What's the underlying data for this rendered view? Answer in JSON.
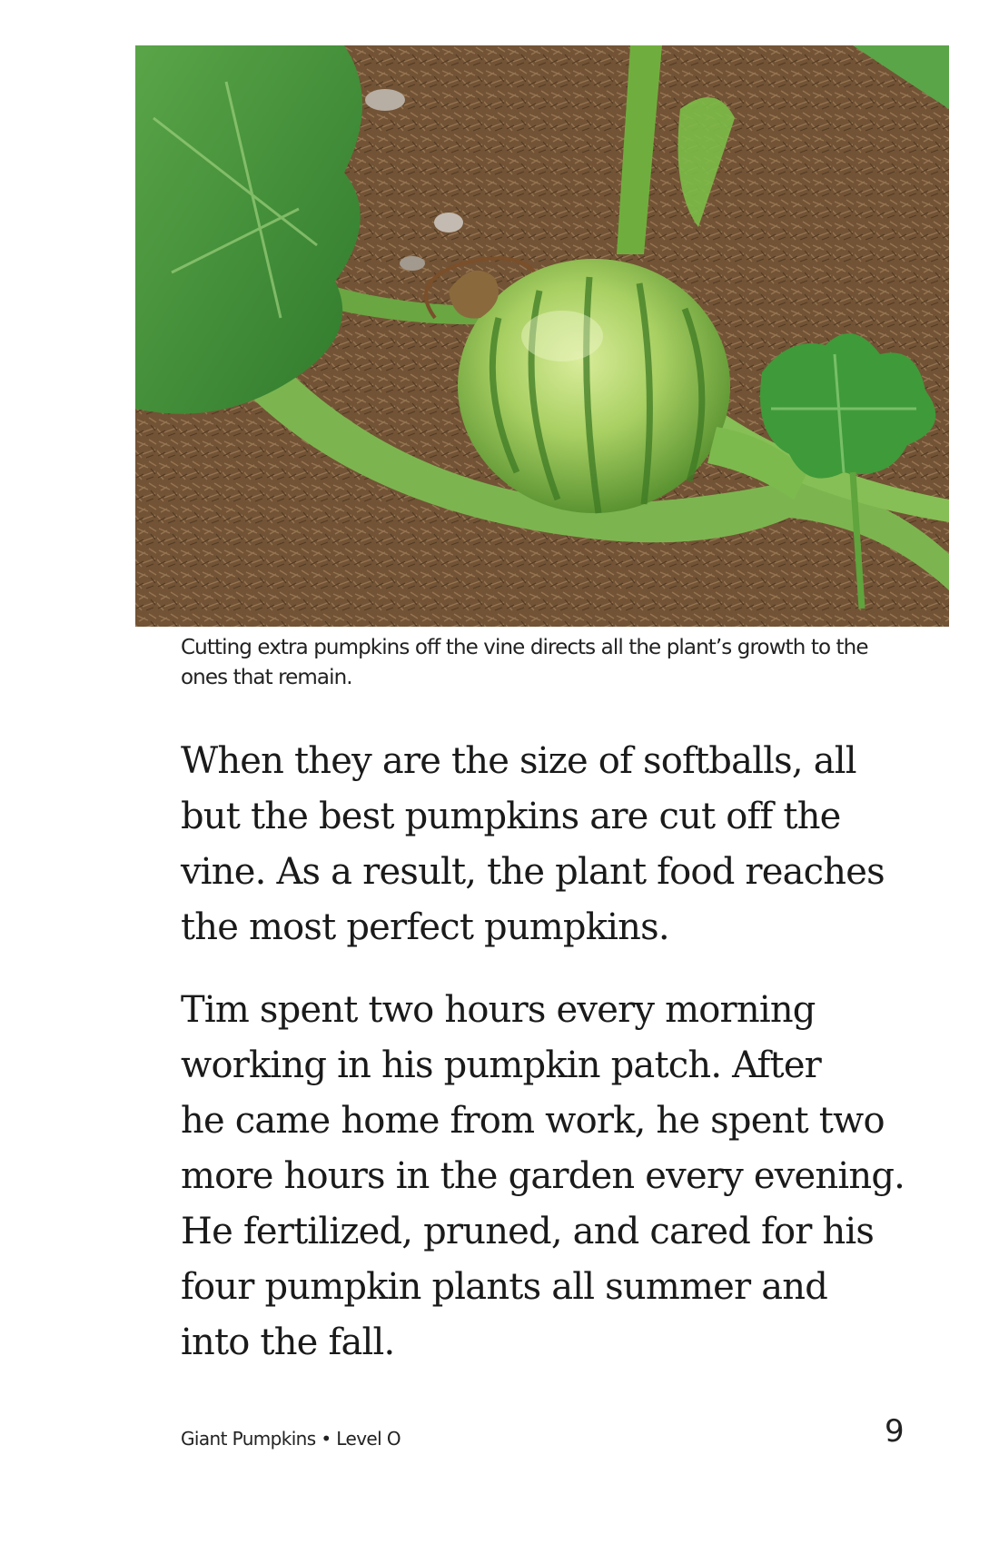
{
  "photo": {
    "subject": "green striped pumpkin growing on a vine in a mulched garden bed"
  },
  "caption": {
    "lines": [
      "Cutting extra pumpkins off the vine directs all the plant’s growth to the",
      "ones that remain."
    ]
  },
  "paragraphs": [
    {
      "lines": [
        "When they are the size of softballs, all",
        "but the best pumpkins are cut off the",
        "vine. As a result, the plant food reaches",
        "the most perfect pumpkins."
      ]
    },
    {
      "lines": [
        "Tim spent two hours every morning",
        "working in his pumpkin patch. After",
        "he came home from work, he spent two",
        "more hours in the garden every evening.",
        "He fertilized, pruned, and cared for his",
        "four pumpkin plants all summer and",
        "into the fall."
      ]
    }
  ],
  "footer": {
    "title": "Giant Pumpkins • Level O",
    "page_number": "9"
  }
}
